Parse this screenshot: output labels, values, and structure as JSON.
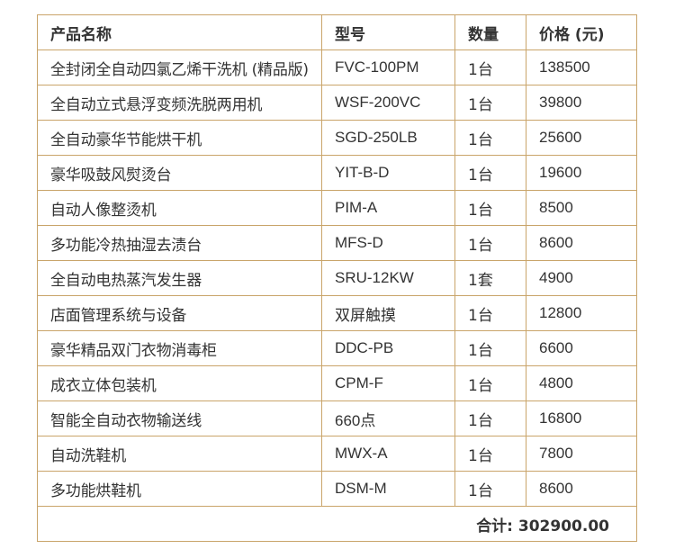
{
  "table": {
    "headers": {
      "name": "产品名称",
      "model": "型号",
      "qty": "数量",
      "price": "价格 (元)"
    },
    "rows": [
      {
        "name": "全封闭全自动四氯乙烯干洗机 (精品版)",
        "model": "FVC-100PM",
        "qty": "1台",
        "price": "138500"
      },
      {
        "name": "全自动立式悬浮变频洗脱两用机",
        "model": "WSF-200VC",
        "qty": "1台",
        "price": "39800"
      },
      {
        "name": "全自动豪华节能烘干机",
        "model": "SGD-250LB",
        "qty": "1台",
        "price": "25600"
      },
      {
        "name": "豪华吸鼓风熨烫台",
        "model": "YIT-B-D",
        "qty": "1台",
        "price": "19600"
      },
      {
        "name": "自动人像整烫机",
        "model": "PIM-A",
        "qty": "1台",
        "price": "8500"
      },
      {
        "name": "多功能冷热抽湿去渍台",
        "model": "MFS-D",
        "qty": "1台",
        "price": "8600"
      },
      {
        "name": "全自动电热蒸汽发生器",
        "model": "SRU-12KW",
        "qty": "1套",
        "price": "4900"
      },
      {
        "name": "店面管理系统与设备",
        "model": "双屏触摸",
        "qty": "1台",
        "price": "12800"
      },
      {
        "name": "豪华精品双门衣物消毒柜",
        "model": "DDC-PB",
        "qty": "1台",
        "price": "6600"
      },
      {
        "name": "成衣立体包装机",
        "model": "CPM-F",
        "qty": "1台",
        "price": "4800"
      },
      {
        "name": "智能全自动衣物输送线",
        "model": "660点",
        "qty": "1台",
        "price": "16800"
      },
      {
        "name": "自动洗鞋机",
        "model": "MWX-A",
        "qty": "1台",
        "price": "7800"
      },
      {
        "name": "多功能烘鞋机",
        "model": "DSM-M",
        "qty": "1台",
        "price": "8600"
      }
    ],
    "total": "合计: 302900.00"
  },
  "colors": {
    "border": "#c9a46a",
    "text": "#333333"
  }
}
